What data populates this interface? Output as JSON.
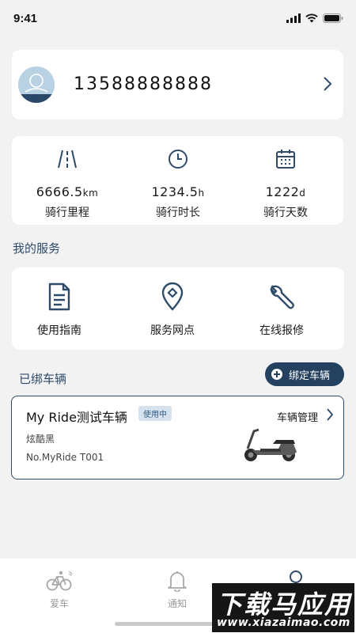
{
  "status_bar": {
    "time": "9:41"
  },
  "profile": {
    "phone": "13588888888"
  },
  "stats": [
    {
      "value": "6666.5",
      "unit": "km",
      "label": "骑行里程",
      "icon": "road-icon"
    },
    {
      "value": "1234.5",
      "unit": "h",
      "label": "骑行时长",
      "icon": "clock-icon"
    },
    {
      "value": "1222",
      "unit": "d",
      "label": "骑行天数",
      "icon": "calendar-icon"
    }
  ],
  "services": {
    "title": "我的服务",
    "items": [
      {
        "label": "使用指南",
        "icon": "document-icon"
      },
      {
        "label": "服务网点",
        "icon": "location-pin-icon"
      },
      {
        "label": "在线报修",
        "icon": "wrench-icon"
      }
    ]
  },
  "vehicles": {
    "title": "已绑车辆",
    "bind_button": "绑定车辆",
    "items": [
      {
        "name": "My Ride测试车辆",
        "badge": "使用中",
        "color": "炫酷黑",
        "plate": "No.MyRide T001",
        "manage": "车辆管理",
        "image": "scooter-image"
      }
    ]
  },
  "tabbar": {
    "items": [
      {
        "label": "爱车",
        "icon": "bike-icon"
      },
      {
        "label": "通知",
        "icon": "bell-icon"
      },
      {
        "label": "",
        "icon": "person-icon"
      }
    ]
  },
  "watermark": {
    "main": "下载马应用",
    "sub": "www.xiazaimao.com"
  },
  "colors": {
    "accent": "#24415f",
    "section_title": "#2f4b6a",
    "background": "#f2f2f3"
  }
}
